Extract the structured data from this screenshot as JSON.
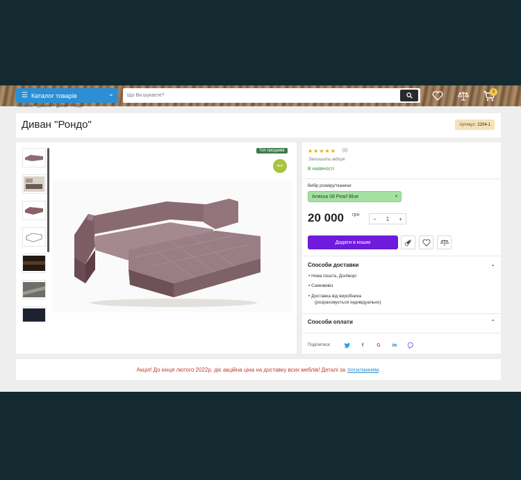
{
  "header": {
    "catalog_label": "Каталог товарів",
    "search_placeholder": "Що Ви шукаєте?",
    "cart_count": "0"
  },
  "breadcrumb": "Головна > Дивани > Диван \"Рондо\"",
  "product": {
    "title": "Диван \"Рондо\"",
    "sku_label": "Артикул:",
    "sku_value": "2204-1",
    "top_sales_badge": "Топ продажів",
    "new_badge": "new",
    "rating_stars": "★★★★★",
    "review_count": "(2)",
    "write_review": "Залишити відгук",
    "stock_status": "В наявності",
    "size_label": "Вибір розміру/тканини:",
    "size_selected": "Аляска 08 Pearl Blue",
    "price": "20 000",
    "currency": "грн",
    "quantity": "1",
    "qty_minus": "−",
    "qty_plus": "+",
    "add_to_cart": "Додати в кошик"
  },
  "delivery": {
    "title": "Способи доставки",
    "items": [
      "Нова пошта, Доліворі",
      "Самовивіз",
      "Доставка від виробника",
      "(розраховується індивідуально)"
    ]
  },
  "payment": {
    "title": "Способи оплати"
  },
  "share": {
    "label": "Поділитися:"
  },
  "promo": {
    "text": "Акція! До кінця лютого 2022р. діє акційна ціна на доставку всих меблів! Деталі за",
    "link": "посиланням",
    "end": "."
  },
  "colors": {
    "accent": "#2b8fd6",
    "cart_button": "#6e1bdc",
    "stock_green": "#2e9b3d",
    "promo_red": "#c0392b",
    "sofa": "#8e6b72"
  }
}
